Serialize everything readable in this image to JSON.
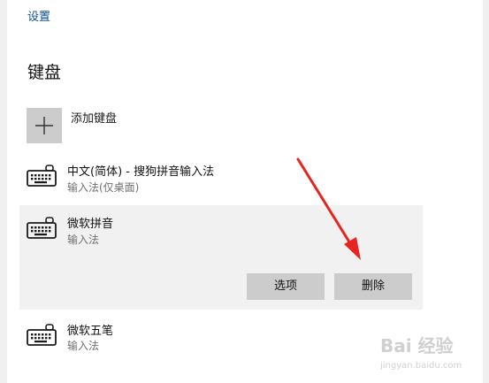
{
  "header": {
    "breadcrumb": "设置",
    "title": "键盘"
  },
  "add_keyboard": {
    "label": "添加键盘",
    "icon": "plus-icon"
  },
  "keyboards": [
    {
      "name": "中文(简体) - 搜狗拼音输入法",
      "type": "输入法(仅桌面)",
      "icon": "keyboard-icon"
    },
    {
      "name": "微软拼音",
      "type": "输入法",
      "icon": "keyboard-icon",
      "selected": true
    },
    {
      "name": "微软五笔",
      "type": "输入法",
      "icon": "keyboard-icon"
    }
  ],
  "actions": {
    "options_label": "选项",
    "remove_label": "删除"
  },
  "colors": {
    "link": "#0a4f94",
    "selected_bg": "#f1f1f1",
    "button_bg": "#cccccc",
    "annotation_arrow": "#e8241f"
  },
  "watermark": {
    "logo_text": "Bai 经验",
    "url": "jingyan.baidu.com"
  }
}
